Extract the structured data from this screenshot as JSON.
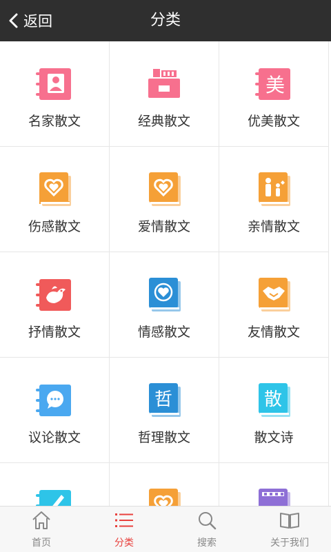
{
  "header": {
    "back_label": "返回",
    "title": "分类"
  },
  "colors": {
    "header_bg": "#2f2f2f",
    "pink": "#f7708e",
    "orange": "#f5a037",
    "red": "#f05a5a",
    "blue": "#2b8fd6",
    "light_blue": "#4aa8f0",
    "cyan": "#2ec4e8",
    "purple": "#8e6fd6",
    "tab_active": "#e8413d",
    "tab_inactive": "#888888"
  },
  "categories": [
    {
      "label": "名家散文",
      "icon": "contact-notebook-icon"
    },
    {
      "label": "经典散文",
      "icon": "cash-register-icon"
    },
    {
      "label": "优美散文",
      "icon": "mei-character-notebook-icon",
      "glyph": "美"
    },
    {
      "label": "伤感散文",
      "icon": "heart-book-icon"
    },
    {
      "label": "爱情散文",
      "icon": "heart-book-icon"
    },
    {
      "label": "亲情散文",
      "icon": "family-book-icon"
    },
    {
      "label": "抒情散文",
      "icon": "bird-notebook-icon"
    },
    {
      "label": "情感散文",
      "icon": "heart-book-icon"
    },
    {
      "label": "友情散文",
      "icon": "handshake-book-icon"
    },
    {
      "label": "议论散文",
      "icon": "chat-notebook-icon"
    },
    {
      "label": "哲理散文",
      "icon": "zhe-character-book-icon",
      "glyph": "哲"
    },
    {
      "label": "散文诗",
      "icon": "san-character-book-icon",
      "glyph": "散"
    },
    {
      "label": "",
      "icon": "pen-notebook-icon"
    },
    {
      "label": "",
      "icon": "heart-book-icon"
    },
    {
      "label": "",
      "icon": "film-book-icon"
    }
  ],
  "tabbar": {
    "tabs": [
      {
        "label": "首页",
        "icon": "home-icon"
      },
      {
        "label": "分类",
        "icon": "list-icon",
        "active": true
      },
      {
        "label": "搜索",
        "icon": "search-icon"
      },
      {
        "label": "关于我们",
        "icon": "open-book-icon"
      }
    ]
  }
}
